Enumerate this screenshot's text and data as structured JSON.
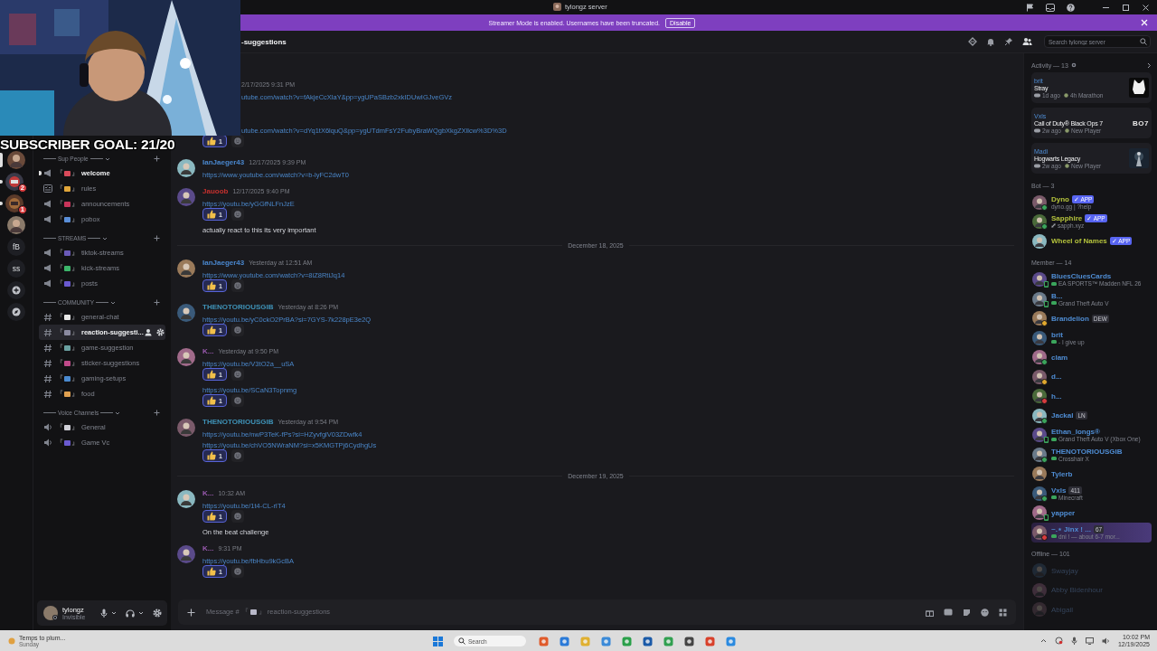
{
  "titlebar": {
    "title": "tylongz server"
  },
  "banner": {
    "text": "Streamer Mode is enabled. Usernames have been truncated.",
    "button": "Disable"
  },
  "overlay": {
    "goal": "SUBSCRIBER GOAL: 21/20"
  },
  "servers": [
    {
      "kind": "avatar",
      "selected": true,
      "unread": false
    },
    {
      "kind": "server",
      "badge": "2",
      "selected": false,
      "unread": true
    },
    {
      "kind": "server",
      "badge": "1",
      "selected": false,
      "unread": true
    },
    {
      "kind": "avatar",
      "selected": false,
      "unread": false
    },
    {
      "kind": "text",
      "text": "fB",
      "selected": false,
      "unread": false
    },
    {
      "kind": "text",
      "text": "ss",
      "selected": false,
      "unread": false
    },
    {
      "kind": "add",
      "selected": false,
      "unread": false
    },
    {
      "kind": "discover",
      "selected": false,
      "unread": false
    }
  ],
  "categories": [
    {
      "name": "Sup People",
      "channels": [
        {
          "kind": "announce",
          "prefix": "『",
          "color": "#d94a5a",
          "suffix": "』",
          "name": "welcome",
          "unread": true,
          "selected": false
        },
        {
          "kind": "rules",
          "prefix": "『",
          "color": "#e0a63a",
          "suffix": "』",
          "name": "rules",
          "unread": false,
          "selected": false
        },
        {
          "kind": "announce",
          "prefix": "『",
          "color": "#c8345a",
          "suffix": "』",
          "name": "announcements",
          "unread": false,
          "selected": false
        },
        {
          "kind": "announce",
          "prefix": "『",
          "color": "#5a8fd8",
          "suffix": "』",
          "name": "pobox",
          "unread": false,
          "selected": false
        }
      ]
    },
    {
      "name": "STREAMS",
      "channels": [
        {
          "kind": "announce",
          "prefix": "『",
          "color": "#6a5ab8",
          "suffix": "』",
          "name": "tiktok-streams",
          "unread": false,
          "selected": false
        },
        {
          "kind": "announce",
          "prefix": "『",
          "color": "#3cb56a",
          "suffix": "』",
          "name": "kick-streams",
          "unread": false,
          "selected": false
        },
        {
          "kind": "announce",
          "prefix": "『",
          "color": "#6a5ad0",
          "suffix": "』",
          "name": "posts",
          "unread": false,
          "selected": false
        }
      ]
    },
    {
      "name": "COMMUNITY",
      "channels": [
        {
          "kind": "text",
          "prefix": "『",
          "color": "#e8e8e8",
          "suffix": "』",
          "name": "general-chat",
          "unread": false,
          "selected": false
        },
        {
          "kind": "text",
          "prefix": "『",
          "color": "#8a8aa0",
          "suffix": "』",
          "name": "reaction-suggesti...",
          "unread": false,
          "selected": true
        },
        {
          "kind": "text",
          "prefix": "『",
          "color": "#6aa0a0",
          "suffix": "』",
          "name": "game-suggestion",
          "unread": false,
          "selected": false
        },
        {
          "kind": "text",
          "prefix": "『",
          "color": "#c04a8a",
          "suffix": "』",
          "name": "sticker-suggestions",
          "unread": false,
          "selected": false
        },
        {
          "kind": "text",
          "prefix": "『",
          "color": "#4a8ad0",
          "suffix": "』",
          "name": "gaming-setups",
          "unread": false,
          "selected": false
        },
        {
          "kind": "text",
          "prefix": "『",
          "color": "#e0a050",
          "suffix": "』",
          "name": "food",
          "unread": false,
          "selected": false
        }
      ]
    },
    {
      "name": "Voice Channels",
      "channels": [
        {
          "kind": "voice",
          "prefix": "『",
          "color": "#d0d0d8",
          "suffix": "』",
          "name": "General",
          "unread": false,
          "selected": false
        },
        {
          "kind": "voice",
          "prefix": "『",
          "color": "#6a5ad0",
          "suffix": "』",
          "name": "Game Vc",
          "unread": false,
          "selected": false
        }
      ]
    }
  ],
  "user": {
    "name": "tylongz",
    "status": "Invisible"
  },
  "header": {
    "channel": "-suggestions",
    "search": {
      "placeholder": "Search tylongz server"
    }
  },
  "chat": {
    "items": [
      {
        "kind": "partial",
        "time": "2/17/2025 9:31 PM",
        "blocks": [
          {
            "kind": "link",
            "text": "utube.com/watch?v=fAkjeCcXlaY&pp=ygUPaSBzb2xkIDUwIGJveGVz"
          }
        ]
      },
      {
        "kind": "partial",
        "blocks": [
          {
            "kind": "link",
            "text": "utube.com/watch?v=dYq1tX6lquQ&pp=ygUTdmFsY2FubyBraWQgbXkgZXllcw%3D%3D"
          },
          {
            "kind": "reaction",
            "count": "1"
          }
        ]
      },
      {
        "kind": "message",
        "author": "IanJaeger43",
        "color": "#4a88cf",
        "time": "12/17/2025 9:39 PM",
        "blocks": [
          {
            "kind": "link",
            "text": "https://www.youtube.com/watch?v=b-lyFC2dwT0"
          }
        ]
      },
      {
        "kind": "message",
        "author": "Jauoob",
        "color": "#c4302e",
        "time": "12/17/2025 9:40 PM",
        "blocks": [
          {
            "kind": "link",
            "text": "https://youtu.be/yGGfNLFnJzE"
          },
          {
            "kind": "reaction",
            "count": "1"
          },
          {
            "kind": "text",
            "text": "actually react to this its very important"
          }
        ]
      },
      {
        "kind": "divider",
        "text": "December 18, 2025"
      },
      {
        "kind": "message",
        "author": "IanJaeger43",
        "color": "#4a88cf",
        "time": "Yesterday at 12:51 AM",
        "blocks": [
          {
            "kind": "link",
            "text": "https://www.youtube.com/watch?v=8iZ8RtiJq14"
          },
          {
            "kind": "reaction",
            "count": "1"
          }
        ]
      },
      {
        "kind": "message",
        "author": "THENOTORIOUSGIB",
        "color": "#3f93b8",
        "time": "Yesterday at 8:26 PM",
        "blocks": [
          {
            "kind": "link",
            "text": "https://youtu.be/yC0ckO2PrBA?si=7GYS-7k228pE3e2Q"
          },
          {
            "kind": "reaction",
            "count": "1"
          }
        ]
      },
      {
        "kind": "message",
        "author": "K...",
        "color": "#9a5ab0",
        "time": "Yesterday at 9:50 PM",
        "blocks": [
          {
            "kind": "link",
            "text": "https://youtu.be/V3tO2a__uSA"
          },
          {
            "kind": "reaction",
            "count": "1"
          },
          {
            "kind": "link",
            "text": "https://youtu.be/SCaN3Topnmg"
          },
          {
            "kind": "reaction",
            "count": "1"
          }
        ]
      },
      {
        "kind": "message",
        "author": "THENOTORIOUSGIB",
        "color": "#3f93b8",
        "time": "Yesterday at 9:54 PM",
        "blocks": [
          {
            "kind": "link",
            "text": "https://youtu.be/nwP3TeK-fPs?si=HZyvfglV03ZDwfk4"
          },
          {
            "kind": "link",
            "text": "https://youtu.be/chVO5NWraNM?si=x5KMGTPj6CydhgUs"
          },
          {
            "kind": "reaction",
            "count": "1"
          }
        ]
      },
      {
        "kind": "divider",
        "text": "December 19, 2025"
      },
      {
        "kind": "message",
        "author": "K...",
        "color": "#9a5ab0",
        "time": "10:32 AM",
        "blocks": [
          {
            "kind": "link",
            "text": "https://youtu.be/1t4-CL-rIT4"
          },
          {
            "kind": "reaction",
            "count": "1"
          },
          {
            "kind": "text",
            "text": "On the beat challenge"
          }
        ]
      },
      {
        "kind": "message",
        "author": "K...",
        "color": "#9a5ab0",
        "time": "9:31 PM",
        "blocks": [
          {
            "kind": "link",
            "text": "https://youtu.be/fbHbu9kGcBA"
          },
          {
            "kind": "reaction",
            "count": "1"
          }
        ]
      }
    ]
  },
  "composer": {
    "placeholder_parts": [
      "Message # 『",
      "』 reaction-suggestions"
    ]
  },
  "members": {
    "activity": {
      "title": "Activity — 13",
      "cards": [
        {
          "user": "brit",
          "game": "Stray",
          "ago": "1d ago",
          "note": "4h Marathon",
          "thumb": {
            "kind": "cat"
          }
        },
        {
          "user": "Vxls",
          "game": "Call of Duty® Black Ops 7",
          "ago": "2w ago",
          "note": "New Player",
          "thumb": {
            "kind": "logo",
            "text": "BO7"
          }
        },
        {
          "user": "Madi",
          "game": "Hogwarts Legacy",
          "ago": "2w ago",
          "note": "New Player"
        }
      ]
    },
    "sections": [
      {
        "title": "Bot — 3",
        "color": "#b4c23c",
        "offline": false,
        "members": [
          {
            "name": "Dyno",
            "tag": {
              "kind": "app",
              "text": "✓ APP"
            },
            "sub": {
              "kind": "custom",
              "text": "dyno.gg | ?help"
            },
            "status": {
              "kind": "online"
            },
            "nameplate": false
          },
          {
            "name": "Sapphire",
            "tag": {
              "kind": "app",
              "text": "✓ APP"
            },
            "sub": {
              "kind": "link",
              "text": "sapph.xyz"
            },
            "status": {
              "kind": "online"
            },
            "nameplate": false
          },
          {
            "name": "Wheel of Names",
            "tag": {
              "kind": "app",
              "text": "✓ APP"
            },
            "nameplate": false
          }
        ]
      },
      {
        "title": "Member — 14",
        "color": "#4f8dd4",
        "offline": false,
        "members": [
          {
            "name": "BluesCluesCards",
            "sub": {
              "kind": "game",
              "text": "EA SPORTS™ Madden NFL 26"
            },
            "status": {
              "kind": "mobile"
            },
            "nameplate": false
          },
          {
            "name": "B...",
            "sub": {
              "kind": "game",
              "text": "Grand Theft Auto V"
            },
            "status": {
              "kind": "mobile"
            },
            "nameplate": false
          },
          {
            "name": "Brandelion",
            "tag": {
              "kind": "role",
              "text": "DEW"
            },
            "status": {
              "kind": "idle"
            },
            "nameplate": false
          },
          {
            "name": "brit",
            "sub": {
              "kind": "game",
              "text": "- I give up"
            },
            "nameplate": false
          },
          {
            "name": "clam",
            "status": {
              "kind": "online"
            },
            "nameplate": false
          },
          {
            "name": "d...",
            "status": {
              "kind": "idle"
            },
            "nameplate": false
          },
          {
            "name": "h...",
            "status": {
              "kind": "dnd"
            },
            "nameplate": false
          },
          {
            "name": "Jackal",
            "tag": {
              "kind": "role",
              "text": "LN"
            },
            "status": {
              "kind": "online"
            },
            "nameplate": false
          },
          {
            "name": "Ethan_longs®",
            "sub": {
              "kind": "game",
              "text": "Grand Theft Auto V (Xbox One)"
            },
            "status": {
              "kind": "mobile"
            },
            "nameplate": false
          },
          {
            "name": "THENOTORIOUSGIB",
            "sub": {
              "kind": "game",
              "text": "Crosshair X"
            },
            "status": {
              "kind": "online"
            },
            "nameplate": false
          },
          {
            "name": "Tylerb",
            "nameplate": false
          },
          {
            "name": "Vxls",
            "tag": {
              "kind": "role",
              "text": "411"
            },
            "sub": {
              "kind": "game",
              "text": "Minecraft"
            },
            "status": {
              "kind": "online"
            },
            "nameplate": false
          },
          {
            "name": "yapper",
            "status": {
              "kind": "mobile"
            },
            "nameplate": false
          },
          {
            "name": "~.⋆ Jinx ! ...",
            "tag": {
              "kind": "role",
              "text": "67"
            },
            "sub": {
              "kind": "game",
              "text": "dni ! — about 6-7 mor..."
            },
            "status": {
              "kind": "dnd"
            },
            "nameplate": true
          }
        ]
      },
      {
        "title": "Offline — 101",
        "color": "#34435a",
        "offline": true,
        "members": [
          {
            "name": "Swayjay",
            "nameplate": false
          },
          {
            "name": "Abby Bidenhour",
            "nameplate": false
          },
          {
            "name": "Abigail",
            "nameplate": false
          }
        ]
      }
    ]
  },
  "taskbar": {
    "weather": {
      "title": "Temps to plum...",
      "sub": "Sunday"
    },
    "search": {
      "placeholder": "Search"
    },
    "time": "10:02 PM",
    "date": "12/19/2025"
  }
}
